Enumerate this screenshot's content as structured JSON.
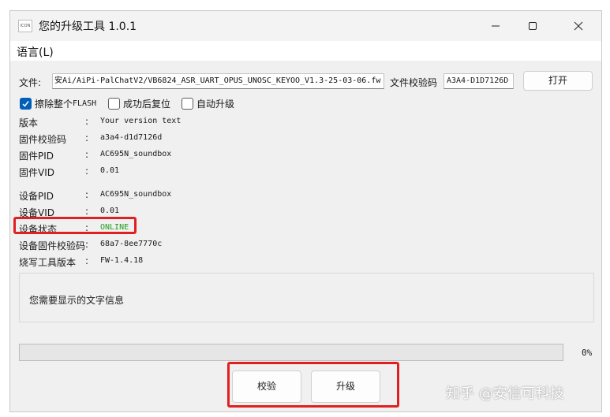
{
  "window": {
    "title": "您的升级工具 1.0.1",
    "icon_text": "ICON"
  },
  "menu": {
    "language": "语言(L)"
  },
  "file_section": {
    "file_label": "文件:",
    "file_path": "安Ai/AiPi-PalChatV2/VB6824_ASR_UART_OPUS_UNOSC_KEYOO_V1.3-25-03-06.fw",
    "checksum_label": "文件校验码",
    "checksum_value": "A3A4-D1D7126D",
    "open_button": "打开"
  },
  "options": {
    "erase_flash": {
      "label": "擦除整个",
      "label_suffix": "FLASH",
      "checked": true
    },
    "reset_after_success": {
      "label": "成功后复位",
      "checked": false
    },
    "auto_upgrade": {
      "label": "自动升级",
      "checked": false
    }
  },
  "info": {
    "separator": ":",
    "rows": [
      {
        "key": "版本",
        "value": "Your version text"
      },
      {
        "key": "固件校验码",
        "value": "a3a4-d1d7126d"
      },
      {
        "key": "固件PID",
        "value": "AC695N_soundbox"
      },
      {
        "key": "固件VID",
        "value": "0.01"
      },
      {
        "key": "设备PID",
        "value": "AC695N_soundbox"
      },
      {
        "key": "设备VID",
        "value": "0.01"
      },
      {
        "key": "设备状态",
        "value": "ONLINE"
      },
      {
        "key": "设备固件校验码",
        "value": "68a7-8ee7770c"
      },
      {
        "key": "烧写工具版本",
        "value": "FW-1.4.18"
      }
    ]
  },
  "message": {
    "text": "您需要显示的文字信息"
  },
  "progress": {
    "percent": 0,
    "label": "0%"
  },
  "actions": {
    "verify_button": "校验",
    "upgrade_button": "升级"
  },
  "watermark": {
    "text": "知乎 @安信可科技"
  },
  "colors": {
    "highlight": "#e02020",
    "online": "#1f9e1f",
    "checkbox_accent": "#005fb8"
  }
}
